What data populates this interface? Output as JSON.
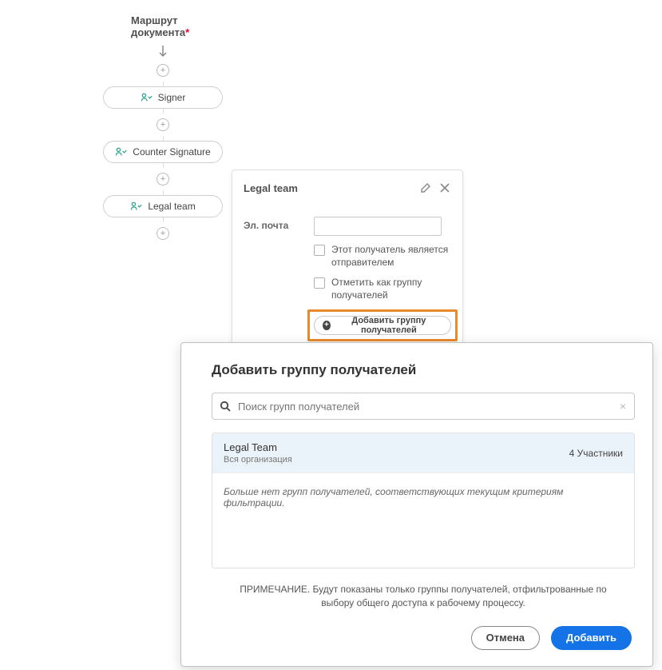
{
  "route": {
    "title": "Маршрут документа",
    "required": "*",
    "steps": [
      "Signer",
      "Counter Signature",
      "Legal team"
    ],
    "add_label": "+"
  },
  "popover": {
    "title": "Legal team",
    "email_label": "Эл. почта",
    "email_value": "",
    "check_sender": "Этот получатель является отправителем",
    "check_group": "Отметить как группу получателей",
    "add_group_btn": "Добавить группу получателей",
    "icons": {
      "edit": "edit-icon",
      "close": "close-icon"
    }
  },
  "modal": {
    "title": "Добавить группу получателей",
    "search_placeholder": "Поиск групп получателей",
    "search_value": "",
    "item": {
      "name": "Legal Team",
      "sub": "Вся организация",
      "right": "4 Участники"
    },
    "empty": "Больше нет групп получателей, соответствующих текущим критериям фильтрации.",
    "note": "ПРИМЕЧАНИЕ. Будут показаны только группы получателей, отфильтрованные по выбору общего доступа к рабочему процессу.",
    "cancel": "Отмена",
    "submit": "Добавить"
  }
}
